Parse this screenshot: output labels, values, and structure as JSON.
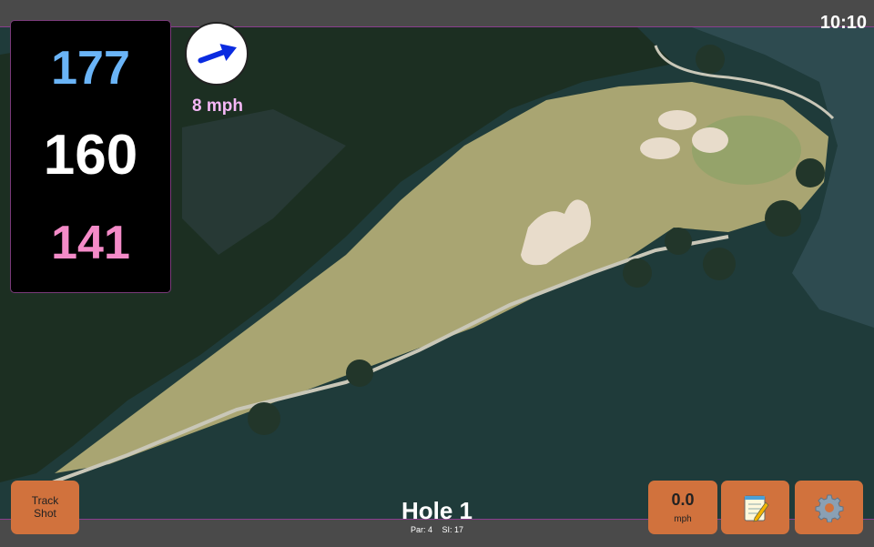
{
  "status": {
    "time": "10:10"
  },
  "distances": {
    "back": {
      "value": "177",
      "color": "#6ab4f7"
    },
    "middle": {
      "value": "160",
      "color": "#ffffff"
    },
    "front": {
      "value": "141",
      "color": "#f48bc8"
    }
  },
  "wind": {
    "speed_label": "8 mph",
    "label_color": "#f6b8f7",
    "arrow_color": "#0a2be0",
    "direction": "northeast"
  },
  "buttons": {
    "track_shot": {
      "line1": "Track",
      "line2": "Shot"
    },
    "speed": {
      "value": "0.0",
      "unit": "mph"
    },
    "notes": {
      "icon": "notepad-icon"
    },
    "settings": {
      "icon": "gear-icon"
    }
  },
  "hole": {
    "title": "Hole 1",
    "par_label": "Par: 4",
    "si_label": "SI: 17"
  },
  "colors": {
    "accent_button": "#d1723d",
    "frame_border": "#8a3e8e"
  }
}
